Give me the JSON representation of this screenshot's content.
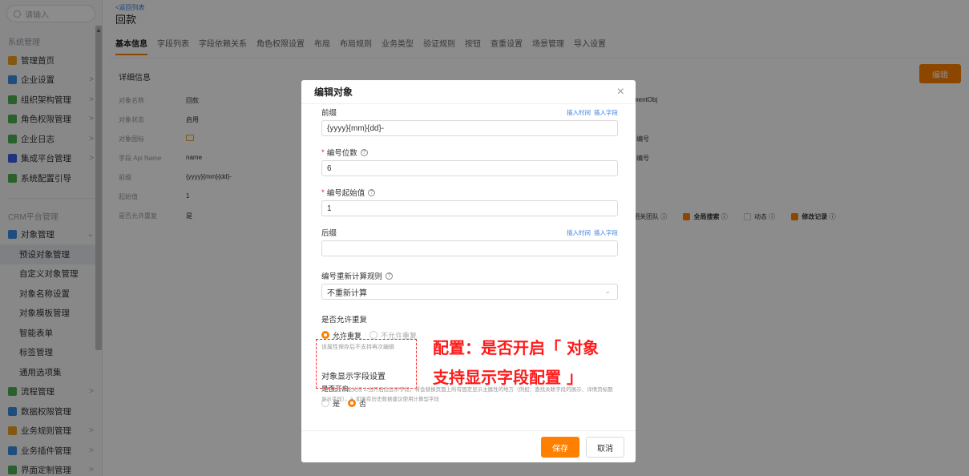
{
  "sidebar": {
    "search_placeholder": "请输入",
    "section1": "系统管理",
    "items": [
      {
        "label": "管理首页",
        "icon": "home-icon",
        "color": "#f0a020",
        "chev": ""
      },
      {
        "label": "企业设置",
        "icon": "building-icon",
        "color": "#3a8ee6",
        "chev": ">"
      },
      {
        "label": "组织架构管理",
        "icon": "org-icon",
        "color": "#4caf50",
        "chev": ">"
      },
      {
        "label": "角色权限管理",
        "icon": "role-icon",
        "color": "#4caf50",
        "chev": ">"
      },
      {
        "label": "企业日志",
        "icon": "log-icon",
        "color": "#4caf50",
        "chev": ">"
      },
      {
        "label": "集成平台管理",
        "icon": "integration-icon",
        "color": "#3a5ee6",
        "chev": ">"
      },
      {
        "label": "系统配置引导",
        "icon": "guide-icon",
        "color": "#4caf50",
        "chev": ""
      }
    ],
    "section2": "CRM平台管理",
    "object_mgmt": {
      "label": "对象管理",
      "chev": "⌄"
    },
    "sub_items": [
      "预设对象管理",
      "自定义对象管理",
      "对象名称设置",
      "对象模板管理",
      "智能表单",
      "标签管理",
      "通用选项集"
    ],
    "items2": [
      {
        "label": "流程管理",
        "icon": "flow-icon",
        "color": "#4caf50",
        "chev": ">"
      },
      {
        "label": "数据权限管理",
        "icon": "data-perm-icon",
        "color": "#3a8ee6",
        "chev": ""
      },
      {
        "label": "业务规则管理",
        "icon": "rule-icon",
        "color": "#f0a020",
        "chev": ">"
      },
      {
        "label": "业务插件管理",
        "icon": "plugin-icon",
        "color": "#3a8ee6",
        "chev": ">"
      },
      {
        "label": "界面定制管理",
        "icon": "ui-icon",
        "color": "#4caf50",
        "chev": ">"
      }
    ]
  },
  "main": {
    "back_link": "<返回列表",
    "title": "回款",
    "tabs": [
      "基本信息",
      "字段列表",
      "字段依赖关系",
      "角色权限设置",
      "布局",
      "布局规则",
      "业务类型",
      "验证规则",
      "按钮",
      "查重设置",
      "场景管理",
      "导入设置"
    ],
    "detail_title": "详细信息",
    "edit_label": "编辑",
    "rows": [
      {
        "k": "对象名称",
        "v": "回款"
      },
      {
        "k": "对象状态",
        "v": "启用"
      },
      {
        "k": "对象图标",
        "v": ""
      },
      {
        "k": "字段 Api Name",
        "v": "name"
      },
      {
        "k": "前缀",
        "v": "{yyyy}{mm}{dd}-"
      },
      {
        "k": "起始值",
        "v": "1"
      },
      {
        "k": "是否允许重复",
        "v": "是"
      }
    ],
    "right_api": "mentObj",
    "right_num1": "编号",
    "right_num2": "编号",
    "right_flags": [
      "相关团队",
      "全局搜索",
      "动态",
      "修改记录"
    ]
  },
  "modal": {
    "title": "编辑对象",
    "prefix_label": "前缀",
    "insert_time": "插入时间",
    "insert_field": "插入字段",
    "prefix_value": "{yyyy}{mm}{dd}-",
    "digits_label": "编号位数",
    "digits_value": "6",
    "start_label": "编号起始值",
    "start_value": "1",
    "suffix_label": "后缀",
    "suffix_value": "",
    "recalc_label": "编号重新计算规则",
    "recalc_value": "不重新计算",
    "dup_label": "是否允许重复",
    "dup_yes": "允许重复",
    "dup_no": "不允许重复",
    "dup_hint": "该属性保存后不支持再次编辑",
    "display_label": "对象显示字段设置",
    "enable_label": "是否开启",
    "opt_yes": "是",
    "opt_no": "否",
    "note": "1.开启后不能关闭 2.当开启后显示字段，将会替换页面上所有固定显示主属性的地方（例如：查找关联字段的展示、详情页标题显示字段）。3. 如果有历史数据建议使用计算型字段",
    "save_label": "保存",
    "cancel_label": "取消"
  },
  "annotation": {
    "line1": "配置：是否开启「 对象",
    "line2": "支持显示字段配置 」"
  }
}
